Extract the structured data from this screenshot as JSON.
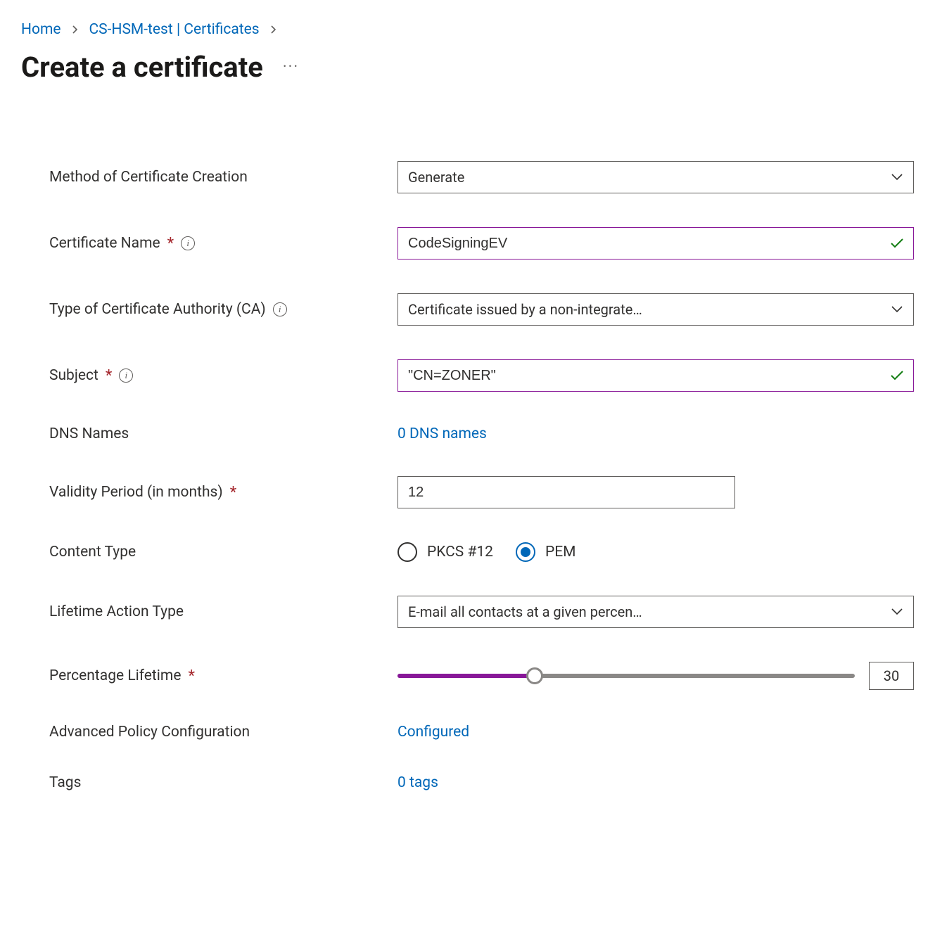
{
  "breadcrumb": {
    "home": "Home",
    "resource": "CS-HSM-test | Certificates"
  },
  "page_title": "Create a certificate",
  "labels": {
    "method": "Method of Certificate Creation",
    "cert_name": "Certificate Name",
    "ca_type": "Type of Certificate Authority (CA)",
    "subject": "Subject",
    "dns_names": "DNS Names",
    "validity": "Validity Period (in months)",
    "content_type": "Content Type",
    "lifetime_action": "Lifetime Action Type",
    "percentage_lifetime": "Percentage Lifetime",
    "advanced_policy": "Advanced Policy Configuration",
    "tags": "Tags"
  },
  "values": {
    "method": "Generate",
    "cert_name": "CodeSigningEV",
    "ca_type": "Certificate issued by a non-integrate…",
    "subject": "\"CN=ZONER\"",
    "dns_names_link": "0 DNS names",
    "validity": "12",
    "content_type_options": {
      "pkcs": "PKCS #12",
      "pem": "PEM"
    },
    "content_type_selected": "pem",
    "lifetime_action": "E-mail all contacts at a given percen…",
    "percentage_lifetime": "30",
    "advanced_policy_link": "Configured",
    "tags_link": "0 tags"
  },
  "slider": {
    "percent": 30
  }
}
